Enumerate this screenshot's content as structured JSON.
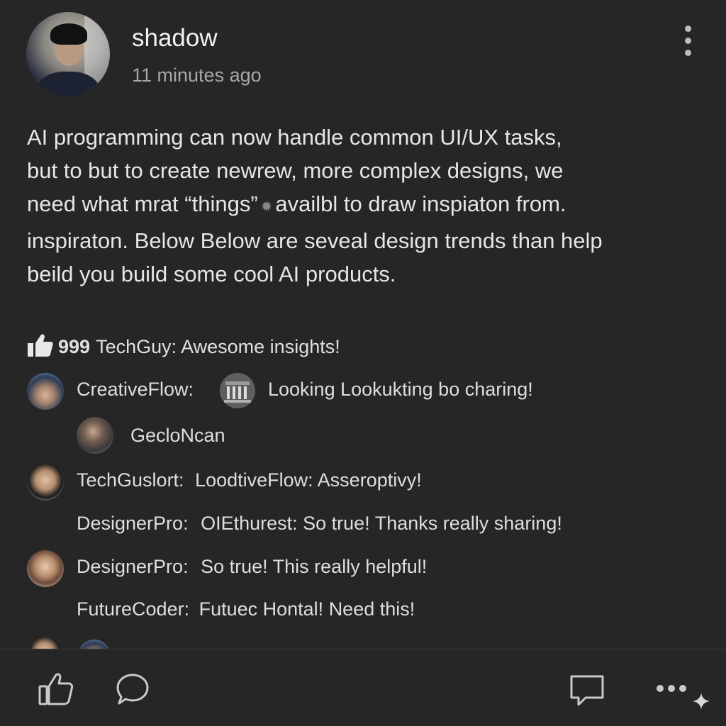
{
  "post": {
    "author": "shadow",
    "time": "11 minutes ago",
    "body_lines": [
      "AI programming can now handle common UI/UX tasks,",
      "but to but to create newrew, more complex designs, we",
      "need what mrat “things”",
      "availbl to draw inspiaton from.",
      "inspiraton. Below Below are seveal design trends than help",
      "beild you build  some cool AI products."
    ]
  },
  "comments": {
    "like_count": "999",
    "top_comment": "TechGuy: Awesome insights!",
    "items": [
      {
        "author": "CreativeFlow:",
        "text": "Looking Lookukting bo charing!"
      },
      {
        "author": "GecloNcan",
        "text": ""
      },
      {
        "author": "TechGuslort:",
        "text": "LoodtiveFlow: Asseroptivy!"
      },
      {
        "author": "DesignerPro:",
        "text": "OIEthurest: So true! Thanks really sharing!"
      },
      {
        "author": "DesignerPro:",
        "text": "So true! This really helpful!"
      },
      {
        "author": "FutureCoder:",
        "text": "Futuec Hontal! Need this!"
      }
    ]
  },
  "icons": {
    "more": "more-vertical-icon",
    "like": "thumbs-up-icon",
    "comment": "speech-bubble-icon",
    "chat": "chat-square-icon",
    "more_h": "more-horizontal-icon",
    "sparkle": "sparkle-icon"
  },
  "colors": {
    "background": "#262626",
    "text": "#e6e6e6",
    "muted": "#a7a7a7",
    "icon": "#bdbdbd"
  }
}
